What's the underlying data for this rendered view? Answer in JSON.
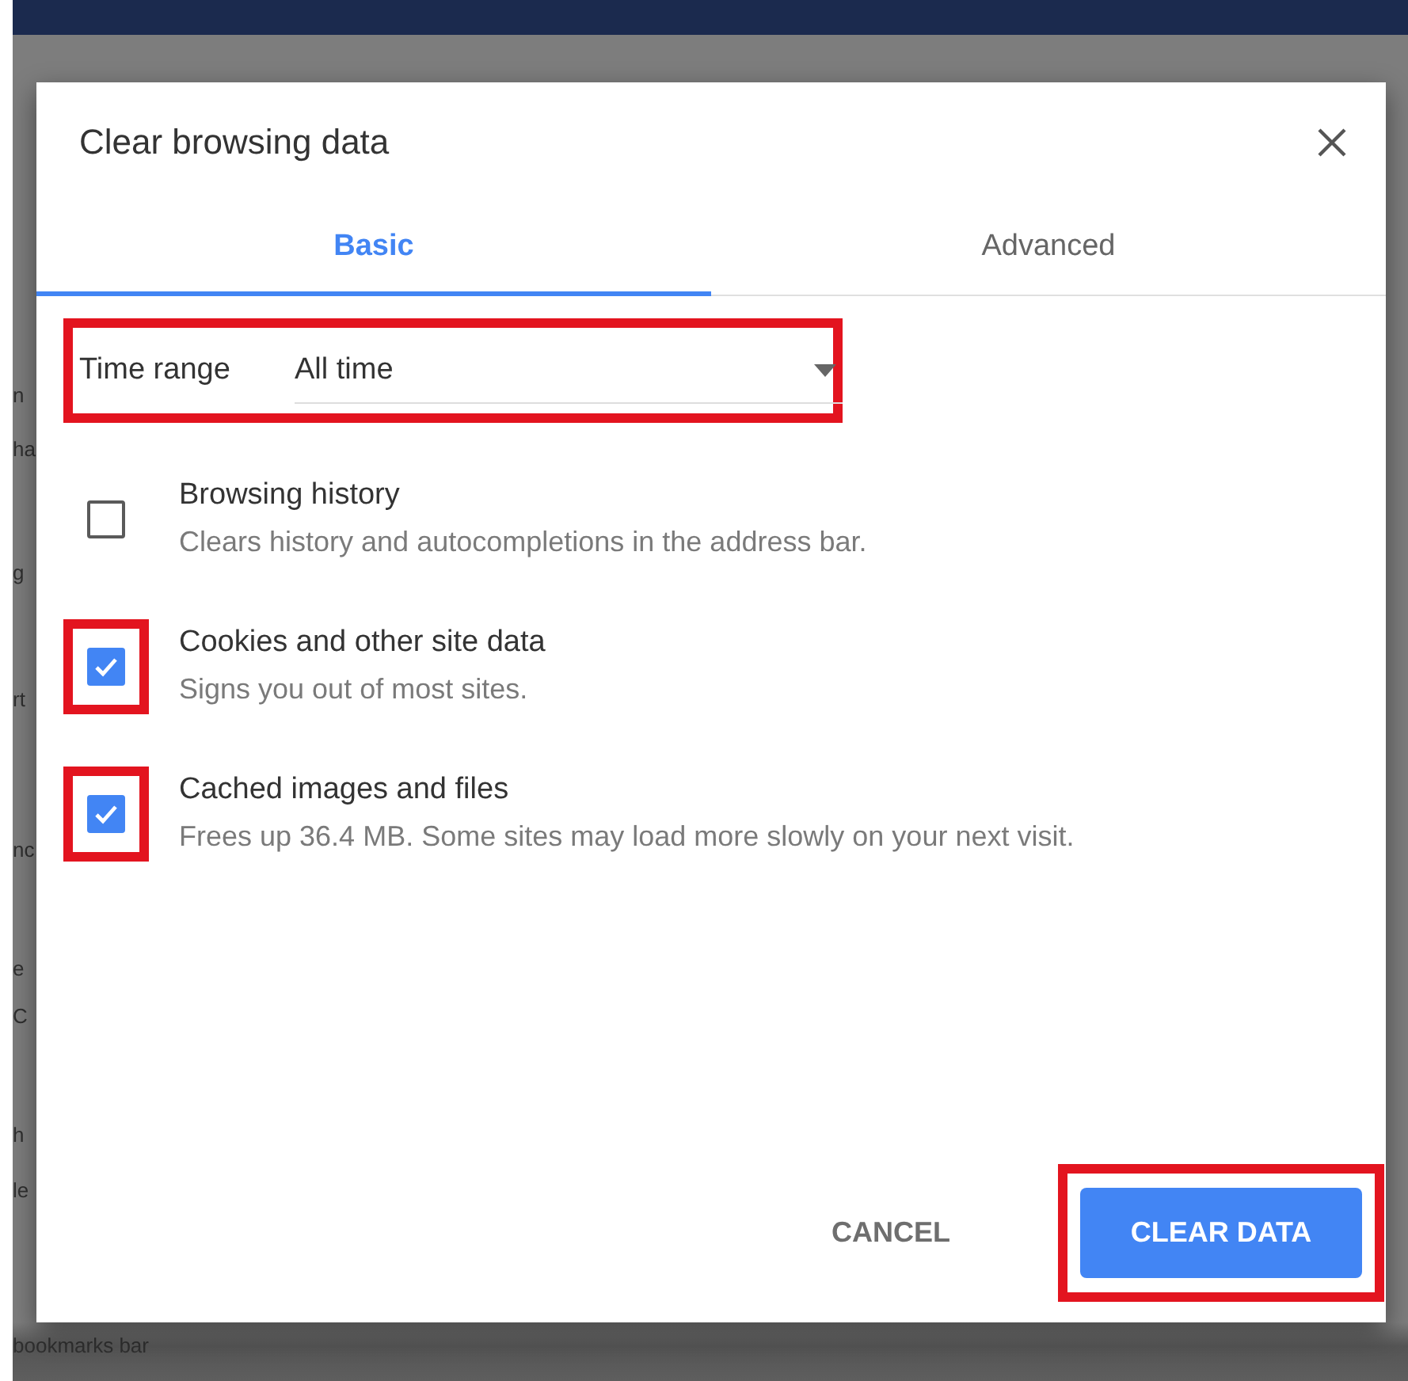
{
  "background": {
    "fragments": [
      "n",
      "ha",
      "g",
      "rt",
      "nc",
      "e",
      "C",
      "h",
      "le",
      "bookmarks bar"
    ]
  },
  "dialog": {
    "title": "Clear browsing data",
    "tabs": [
      {
        "label": "Basic",
        "selected": true
      },
      {
        "label": "Advanced",
        "selected": false
      }
    ],
    "time_range": {
      "label": "Time range",
      "value": "All time",
      "highlighted": true
    },
    "options": [
      {
        "title": "Browsing history",
        "description": "Clears history and autocompletions in the address bar.",
        "checked": false,
        "highlighted": false
      },
      {
        "title": "Cookies and other site data",
        "description": "Signs you out of most sites.",
        "checked": true,
        "highlighted": true
      },
      {
        "title": "Cached images and files",
        "description": "Frees up 36.4 MB. Some sites may load more slowly on your next visit.",
        "checked": true,
        "highlighted": true
      }
    ],
    "buttons": [
      {
        "label": "CANCEL",
        "kind": "text",
        "highlighted": false
      },
      {
        "label": "CLEAR DATA",
        "kind": "primary",
        "highlighted": true
      }
    ]
  }
}
